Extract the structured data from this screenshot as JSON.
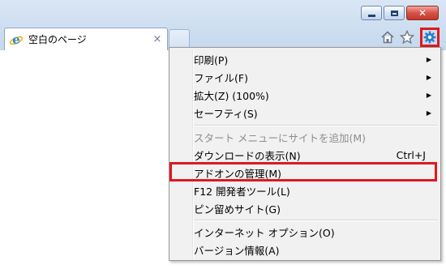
{
  "tab": {
    "title": "空白のページ",
    "close_glyph": "×"
  },
  "window": {
    "close_glyph": "✕"
  },
  "toolbar": {
    "icons": [
      "home-icon",
      "favorites-star-icon",
      "tools-gear-icon"
    ],
    "highlight_color": "#e0181d"
  },
  "menu": {
    "items": [
      {
        "label": "印刷(P)",
        "submenu": true
      },
      {
        "label": "ファイル(F)",
        "submenu": true
      },
      {
        "label": "拡大(Z) (100%)",
        "submenu": true
      },
      {
        "label": "セーフティ(S)",
        "submenu": true
      },
      {
        "label": "スタート メニューにサイトを追加(M)",
        "disabled": true
      },
      {
        "label": "ダウンロードの表示(N)",
        "accel": "Ctrl+J"
      },
      {
        "label": "アドオンの管理(M)",
        "highlighted": true
      },
      {
        "label": "F12 開発者ツール(L)"
      },
      {
        "label": "ピン留めサイト(G)"
      },
      {
        "label": "インターネット オプション(O)"
      },
      {
        "label": "バージョン情報(A)"
      }
    ],
    "arrow_glyph": "▶"
  }
}
